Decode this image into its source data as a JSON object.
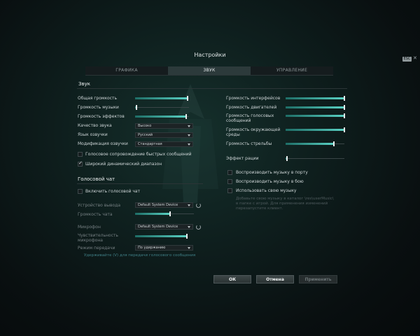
{
  "title": "Настройки",
  "esc_label": "ESC",
  "tabs": [
    "ГРАФИКА",
    "ЗВУК",
    "УПРАВЛЕНИЕ"
  ],
  "sound_section": {
    "title": "Звук",
    "sliders_left": [
      {
        "label": "Общая громкость",
        "value": 0.98
      },
      {
        "label": "Громкость музыки",
        "value": 0.02
      },
      {
        "label": "Громкость эффектов",
        "value": 0.95
      }
    ],
    "quality": {
      "label": "Качество звука",
      "value": "Высоко"
    },
    "voice_lang": {
      "label": "Язык озвучки",
      "value": "Русский"
    },
    "voice_mod": {
      "label": "Модификация озвучки",
      "value": "Стандартная"
    },
    "quick_msgs": {
      "label": "Голосовое сопровождение быстрых сообщений",
      "checked": false
    },
    "wide_range": {
      "label": "Широкий динамический диапазон",
      "checked": true
    },
    "sliders_right": [
      {
        "label": "Громкость интерфейсов",
        "value": 1.0
      },
      {
        "label": "Громкость двигателей",
        "value": 1.0
      },
      {
        "label": "Громкость голосовых\nсообщений",
        "value": 1.0
      },
      {
        "label": "Громкость окружающей\nсреды",
        "value": 1.0
      },
      {
        "label": "Громкость стрельбы",
        "value": 0.82
      }
    ],
    "radio_effect": {
      "label": "Эффект рации",
      "value": 0.02
    },
    "music_port": {
      "label": "Воспроизводить музыку в порту",
      "checked": false
    },
    "music_battle": {
      "label": "Воспроизводить музыку в бою",
      "checked": false
    },
    "own_music": {
      "label": "Использовать свою музыку",
      "checked": false
    },
    "own_music_note": "Добавьте свою музыку в каталог \\res\\userMusic\\\nв папке с игрой. Для применения изменений\nперезапустите клиент."
  },
  "voice_section": {
    "title": "Голосовой чат",
    "enable": {
      "label": "Включить голосовой чат",
      "checked": false
    },
    "output_device": {
      "label": "Устройство вывода",
      "value": "Default System Device"
    },
    "chat_volume": {
      "label": "Громкость чата",
      "value": 0.6
    },
    "microphone": {
      "label": "Микрофон",
      "value": "Default System Device"
    },
    "mic_sensitivity": {
      "label": "Чувствительность\nмикрофона",
      "value": 0.98
    },
    "transmit_mode": {
      "label": "Режим передачи",
      "value": "По удержанию"
    },
    "hint": "Удерживайте (V) для передачи голосового сообщения"
  },
  "buttons": {
    "ok": "ОК",
    "cancel": "Отмена",
    "apply": "Применить"
  }
}
